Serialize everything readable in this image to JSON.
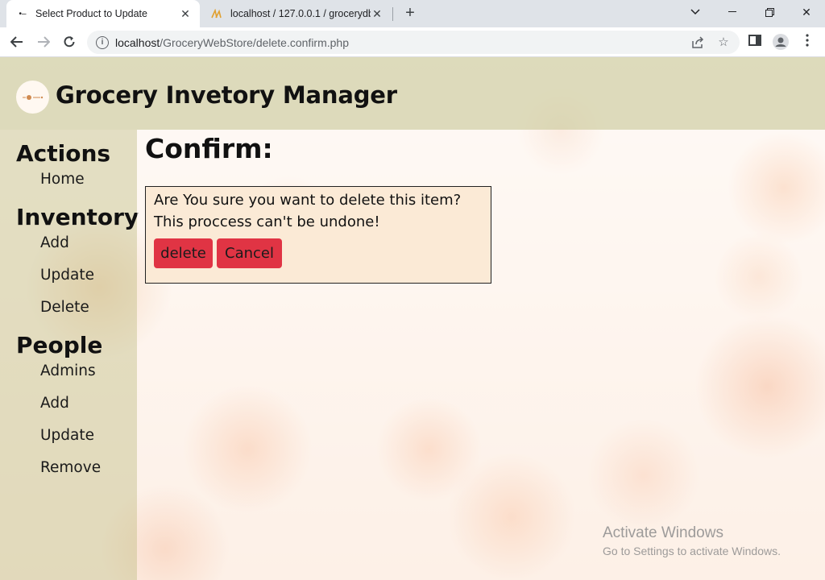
{
  "browser": {
    "tabs": [
      {
        "title": "Select Product to Update",
        "active": true
      },
      {
        "title": "localhost / 127.0.0.1 / grocerydb",
        "active": false
      }
    ],
    "url": {
      "host": "localhost",
      "path": "/GroceryWebStore/delete.confirm.php"
    }
  },
  "site": {
    "title": "Grocery Invetory Manager"
  },
  "sidebar": {
    "sections": [
      {
        "heading": "Actions",
        "items": [
          "Home"
        ]
      },
      {
        "heading": "Inventory",
        "items": [
          "Add",
          "Update",
          "Delete"
        ]
      },
      {
        "heading": "People",
        "items": [
          "Admins",
          "Add",
          "Update",
          "Remove"
        ]
      }
    ]
  },
  "main": {
    "title": "Confirm:",
    "message": "Are You sure you want to delete this item? This proccess can't be undone!",
    "delete_label": "delete",
    "cancel_label": "Cancel"
  },
  "watermark": {
    "line1": "Activate Windows",
    "line2": "Go to Settings to activate Windows."
  },
  "colors": {
    "header_bg": "#d6d4b0",
    "confirm_bg": "#fbead6",
    "button_red": "#e03444"
  }
}
